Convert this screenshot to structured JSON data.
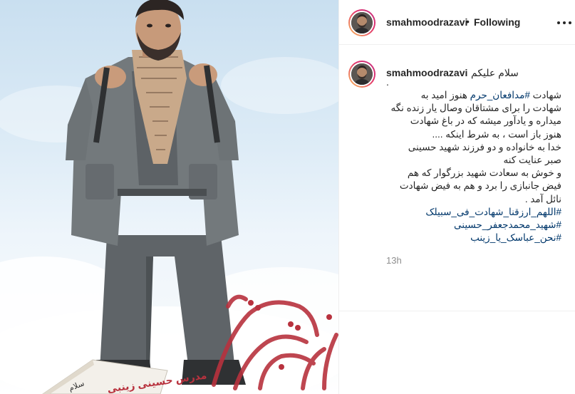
{
  "post": {
    "image_alt": "Illustrated portrait poster of a man in a grey field uniform with a keffiyeh scarf",
    "poster_text": "مدرس حسینی زینبی",
    "poster_text_2": "سلام"
  },
  "header": {
    "username": "smahmoodrazavi",
    "separator": "•",
    "follow_status": "Following",
    "more_icon": "more-horizontal-icon"
  },
  "caption": {
    "username": "smahmoodrazavi",
    "greeting": "سلام علیکم",
    "dot": ".",
    "lines": [
      {
        "pre": "شهادت ",
        "tag": "#مدافعان_حرم",
        "post": " هنوز امید به"
      },
      {
        "pre": "شهادت را برای مشتاقان وصال یار زنده نگه",
        "tag": "",
        "post": ""
      },
      {
        "pre": "میداره و یادآور میشه که در باغ شهادت",
        "tag": "",
        "post": ""
      },
      {
        "pre": "هنوز باز است ، به شرط اینکه ....",
        "tag": "",
        "post": ""
      },
      {
        "pre": "خدا به خانواده و دو فرزند شهید حسینی",
        "tag": "",
        "post": ""
      },
      {
        "pre": "صبر عنایت کنه",
        "tag": "",
        "post": ""
      },
      {
        "pre": "و خوش به سعادت شهید بزرگوار که هم",
        "tag": "",
        "post": ""
      },
      {
        "pre": "فیض جانبازی را برد و هم به فیض شهادت",
        "tag": "",
        "post": ""
      },
      {
        "pre": "نائل آمد .",
        "tag": "",
        "post": ""
      },
      {
        "pre": "",
        "tag": "#اللهم_ارزقنا_شهادت_فی_سبیلک",
        "post": ""
      },
      {
        "pre": "",
        "tag": "#شهید_محمدجعفر_حسینی",
        "post": ""
      },
      {
        "pre": "",
        "tag": "#نحن_عباسک_یا_زینب",
        "post": ""
      }
    ],
    "time": "13h"
  },
  "colors": {
    "text": "#262626",
    "hashtag": "#00376b",
    "muted": "#8e8e8e",
    "border": "#efefef",
    "story_ring_start": "#f9c25c",
    "story_ring_end": "#c13584",
    "calligraphy": "#b8323e"
  }
}
